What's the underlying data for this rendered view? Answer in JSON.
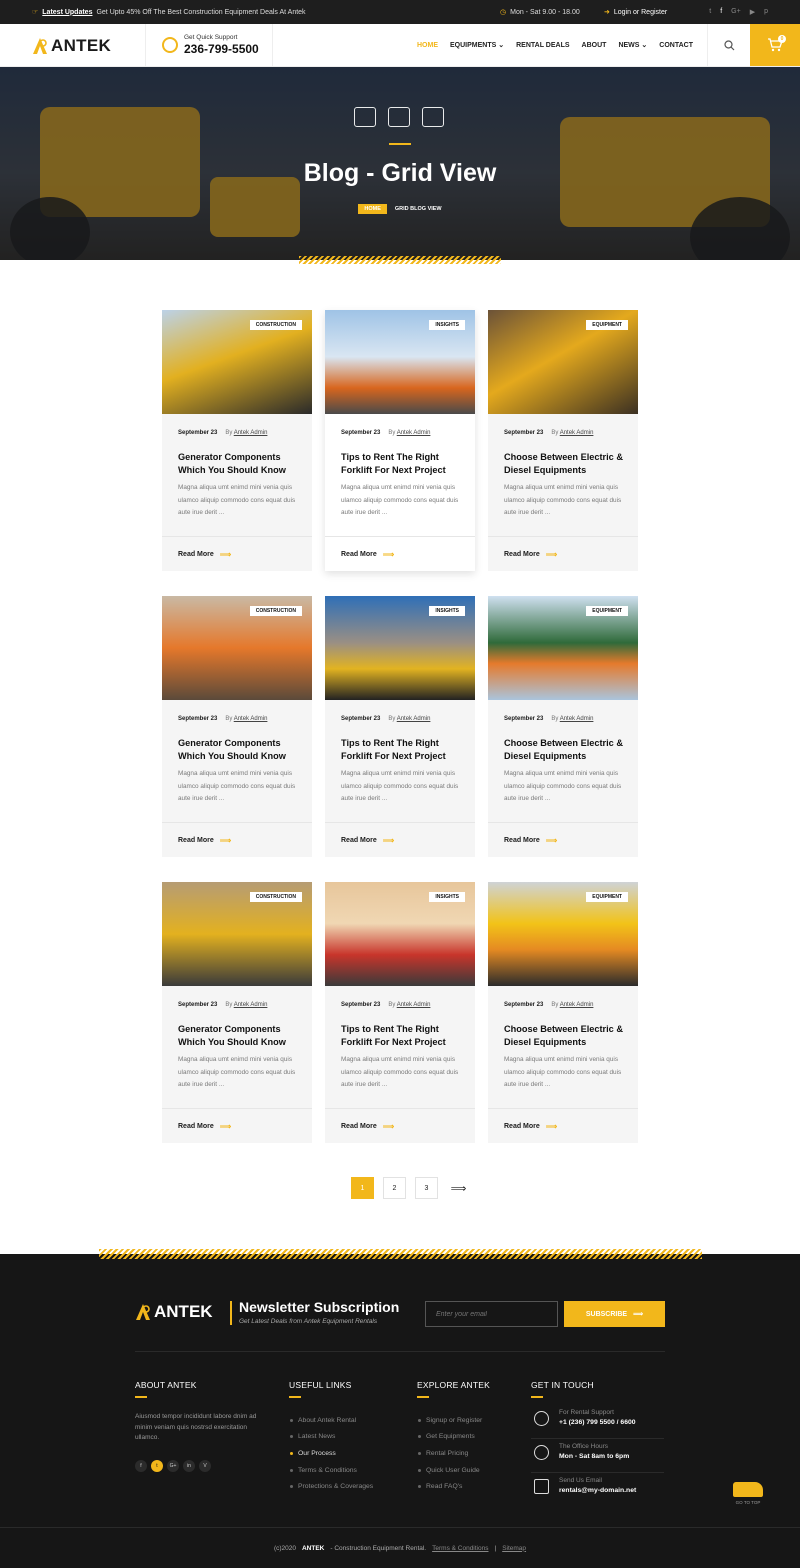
{
  "colors": {
    "accent": "#f2b71b",
    "dark": "#161616",
    "topbar": "#1e1e1e"
  },
  "topbar": {
    "updates_label": "Latest Updates",
    "updates_text": "Get Upto 45% Off The Best Construction Equipment Deals At Antek",
    "hours": "Mon - Sat  9.00 - 18.00",
    "login": "Login or Register",
    "socials": [
      "twitter-icon",
      "facebook-icon",
      "google-plus-icon",
      "youtube-icon",
      "pinterest-icon"
    ]
  },
  "header": {
    "logo": "ANTEK",
    "support_label": "Get Quick Support",
    "phone": "236-799-5500",
    "nav": [
      "HOME",
      "EQUIPMENTS",
      "RENTAL DEALS",
      "ABOUT",
      "NEWS",
      "CONTACT"
    ],
    "cart_count": "0"
  },
  "hero": {
    "title": "Blog - Grid View",
    "crumb_home": "HOME",
    "crumb_current": "GRID BLOG VIEW"
  },
  "posts": [
    {
      "tag": "CONSTRUCTION",
      "date": "September 23",
      "by": "By",
      "author": "Antek Admin",
      "title": "Generator Components Which You Should Know",
      "excerpt": "Magna aliqua umt enimd mini venia quis ulamco aliquip commodo cons equat duis aute irue derit ...",
      "read": "Read More"
    },
    {
      "tag": "INSIGHTS",
      "date": "September 23",
      "by": "By",
      "author": "Antek Admin",
      "title": "Tips to Rent The Right Forklift For Next Project",
      "excerpt": "Magna aliqua umt enimd mini venia quis ulamco aliquip commodo cons equat duis aute irue derit ...",
      "read": "Read More"
    },
    {
      "tag": "EQUIPMENT",
      "date": "September 23",
      "by": "By",
      "author": "Antek Admin",
      "title": "Choose Between Electric & Diesel Equipments",
      "excerpt": "Magna aliqua umt enimd mini venia quis ulamco aliquip commodo cons equat duis aute irue derit ...",
      "read": "Read More"
    },
    {
      "tag": "CONSTRUCTION",
      "date": "September 23",
      "by": "By",
      "author": "Antek Admin",
      "title": "Generator Components Which You Should Know",
      "excerpt": "Magna aliqua umt enimd mini venia quis ulamco aliquip commodo cons equat duis aute irue derit ...",
      "read": "Read More"
    },
    {
      "tag": "INSIGHTS",
      "date": "September 23",
      "by": "By",
      "author": "Antek Admin",
      "title": "Tips to Rent The Right Forklift For Next Project",
      "excerpt": "Magna aliqua umt enimd mini venia quis ulamco aliquip commodo cons equat duis aute irue derit ...",
      "read": "Read More"
    },
    {
      "tag": "EQUIPMENT",
      "date": "September 23",
      "by": "By",
      "author": "Antek Admin",
      "title": "Choose Between Electric & Diesel Equipments",
      "excerpt": "Magna aliqua umt enimd mini venia quis ulamco aliquip commodo cons equat duis aute irue derit ...",
      "read": "Read More"
    },
    {
      "tag": "CONSTRUCTION",
      "date": "September 23",
      "by": "By",
      "author": "Antek Admin",
      "title": "Generator Components Which You Should Know",
      "excerpt": "Magna aliqua umt enimd mini venia quis ulamco aliquip commodo cons equat duis aute irue derit ...",
      "read": "Read More"
    },
    {
      "tag": "INSIGHTS",
      "date": "September 23",
      "by": "By",
      "author": "Antek Admin",
      "title": "Tips to Rent The Right Forklift For Next Project",
      "excerpt": "Magna aliqua umt enimd mini venia quis ulamco aliquip commodo cons equat duis aute irue derit ...",
      "read": "Read More"
    },
    {
      "tag": "EQUIPMENT",
      "date": "September 23",
      "by": "By",
      "author": "Antek Admin",
      "title": "Choose Between Electric & Diesel Equipments",
      "excerpt": "Magna aliqua umt enimd mini venia quis ulamco aliquip commodo cons equat duis aute irue derit ...",
      "read": "Read More"
    }
  ],
  "pagination": {
    "pages": [
      "1",
      "2",
      "3"
    ],
    "next": "⟹"
  },
  "footer": {
    "logo": "ANTEK",
    "newsletter_title": "Newsletter Subscription",
    "newsletter_sub": "Get Latest Deals from Antek Equipment Rentals",
    "email_placeholder": "Enter your email",
    "subscribe": "SUBSCRIBE",
    "about_title": "ABOUT ANTEK",
    "about_text": "Aiusmod tempor incididunt labore dnim ad minim veniam quis nostrsd exercitation ullamco.",
    "about_socials": [
      "f",
      "t",
      "G+",
      "in",
      "V"
    ],
    "useful_title": "USEFUL LINKS",
    "useful": [
      "About Antek Rental",
      "Latest News",
      "Our Process",
      "Terms & Conditions",
      "Protections & Coverages"
    ],
    "explore_title": "EXPLORE ANTEK",
    "explore": [
      "Signup or Register",
      "Get Equipments",
      "Rental Pricing",
      "Quick User Guide",
      "Read FAQ's"
    ],
    "touch_title": "GET IN TOUCH",
    "contacts": [
      {
        "icon": "phone-icon",
        "label": "For Rental Support",
        "value": "+1 (236) 799 5500 / 6600"
      },
      {
        "icon": "clock-icon",
        "label": "The Office Hours",
        "value": "Mon - Sat 8am to 6pm"
      },
      {
        "icon": "mail-icon",
        "label": "Send Us Email",
        "value": "rentals@my-domain.net"
      }
    ],
    "gotop": "GO TO TOP",
    "copy_pre": "(c)2020",
    "copy_brand": "ANTEK",
    "copy_rest": "- Construction Equipment Rental.",
    "terms": "Terms & Conditions",
    "sitemap": "Sitemap"
  }
}
